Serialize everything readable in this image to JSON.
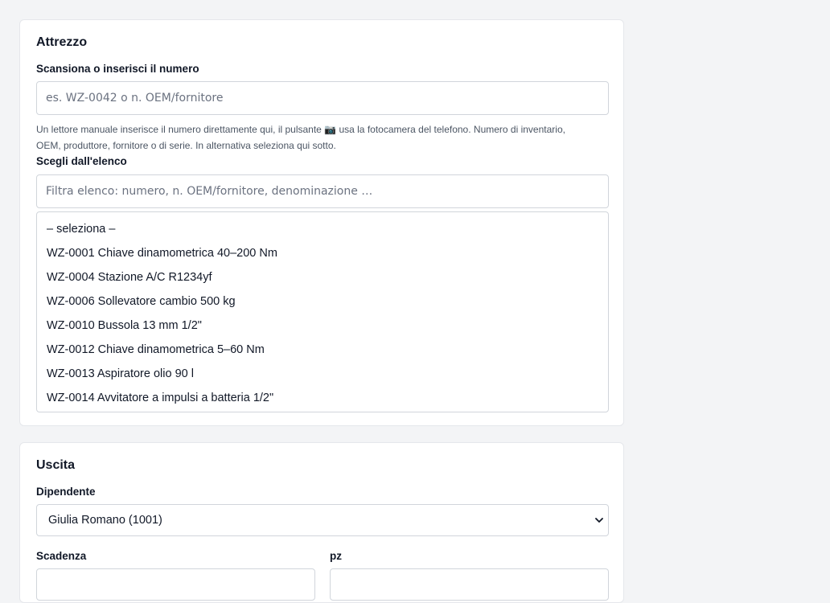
{
  "tool_section": {
    "title": "Attrezzo",
    "scan_label": "Scansiona o inserisci il numero",
    "scan_placeholder": "es. WZ-0042 o n. OEM/fornitore",
    "hint_line1": "Un lettore manuale inserisce il numero direttamente qui, il pulsante 📷 usa la fotocamera del telefono. Numero di inventario,",
    "hint_line2": "OEM, produttore, fornitore o di serie. In alternativa seleziona qui sotto.",
    "list_label": "Scegli dall'elenco",
    "filter_placeholder": "Filtra elenco: numero, n. OEM/fornitore, denominazione …",
    "options": [
      "– seleziona –",
      "WZ-0001 Chiave dinamometrica 40–200 Nm",
      "WZ-0004 Stazione A/C R1234yf",
      "WZ-0006 Sollevatore cambio 500 kg",
      "WZ-0010 Bussola 13 mm 1/2\"",
      "WZ-0012 Chiave dinamometrica 5–60 Nm",
      "WZ-0013 Aspiratore olio 90 l",
      "WZ-0014 Avvitatore a impulsi a batteria 1/2\""
    ]
  },
  "checkout_section": {
    "title": "Uscita",
    "employee_label": "Dipendente",
    "employee_value": "Giulia Romano (1001)",
    "due_label": "Scadenza",
    "qty_label": "pz"
  }
}
